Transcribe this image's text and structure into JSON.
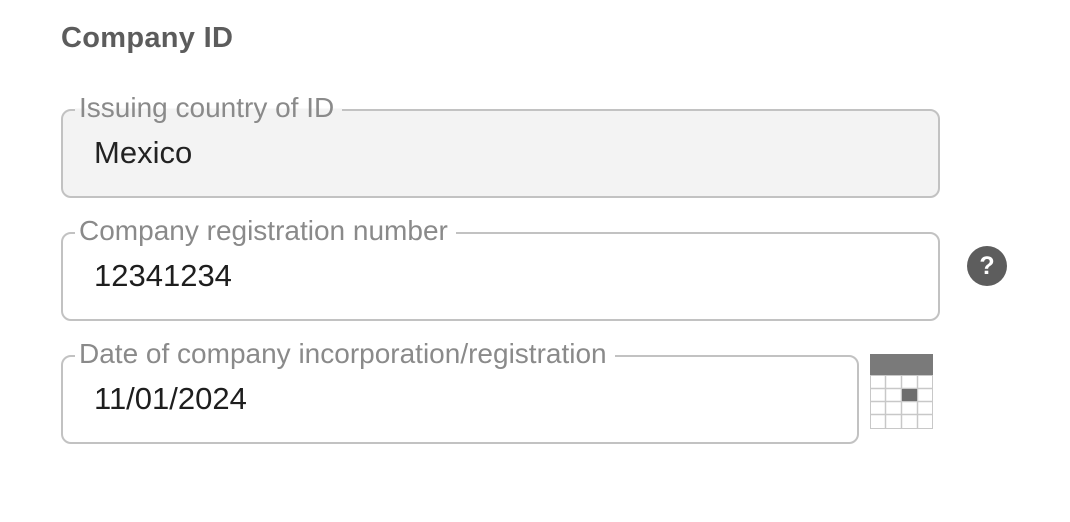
{
  "section": {
    "title": "Company ID"
  },
  "fields": {
    "issuing_country": {
      "label": "Issuing country of ID",
      "value": "Mexico"
    },
    "registration_number": {
      "label": "Company registration number",
      "value": "12341234"
    },
    "incorporation_date": {
      "label": "Date of company incorporation/registration",
      "value": "11/01/2024"
    }
  },
  "icons": {
    "help": "question-mark-circle-icon",
    "help_glyph": "?",
    "calendar": "calendar-icon"
  },
  "colors": {
    "border": "#c2c2c2",
    "readonly_bg": "#f3f3f3",
    "label_text": "#8a8a8a",
    "title_text": "#5c5c5c",
    "icon_dark": "#5d5d5d"
  }
}
